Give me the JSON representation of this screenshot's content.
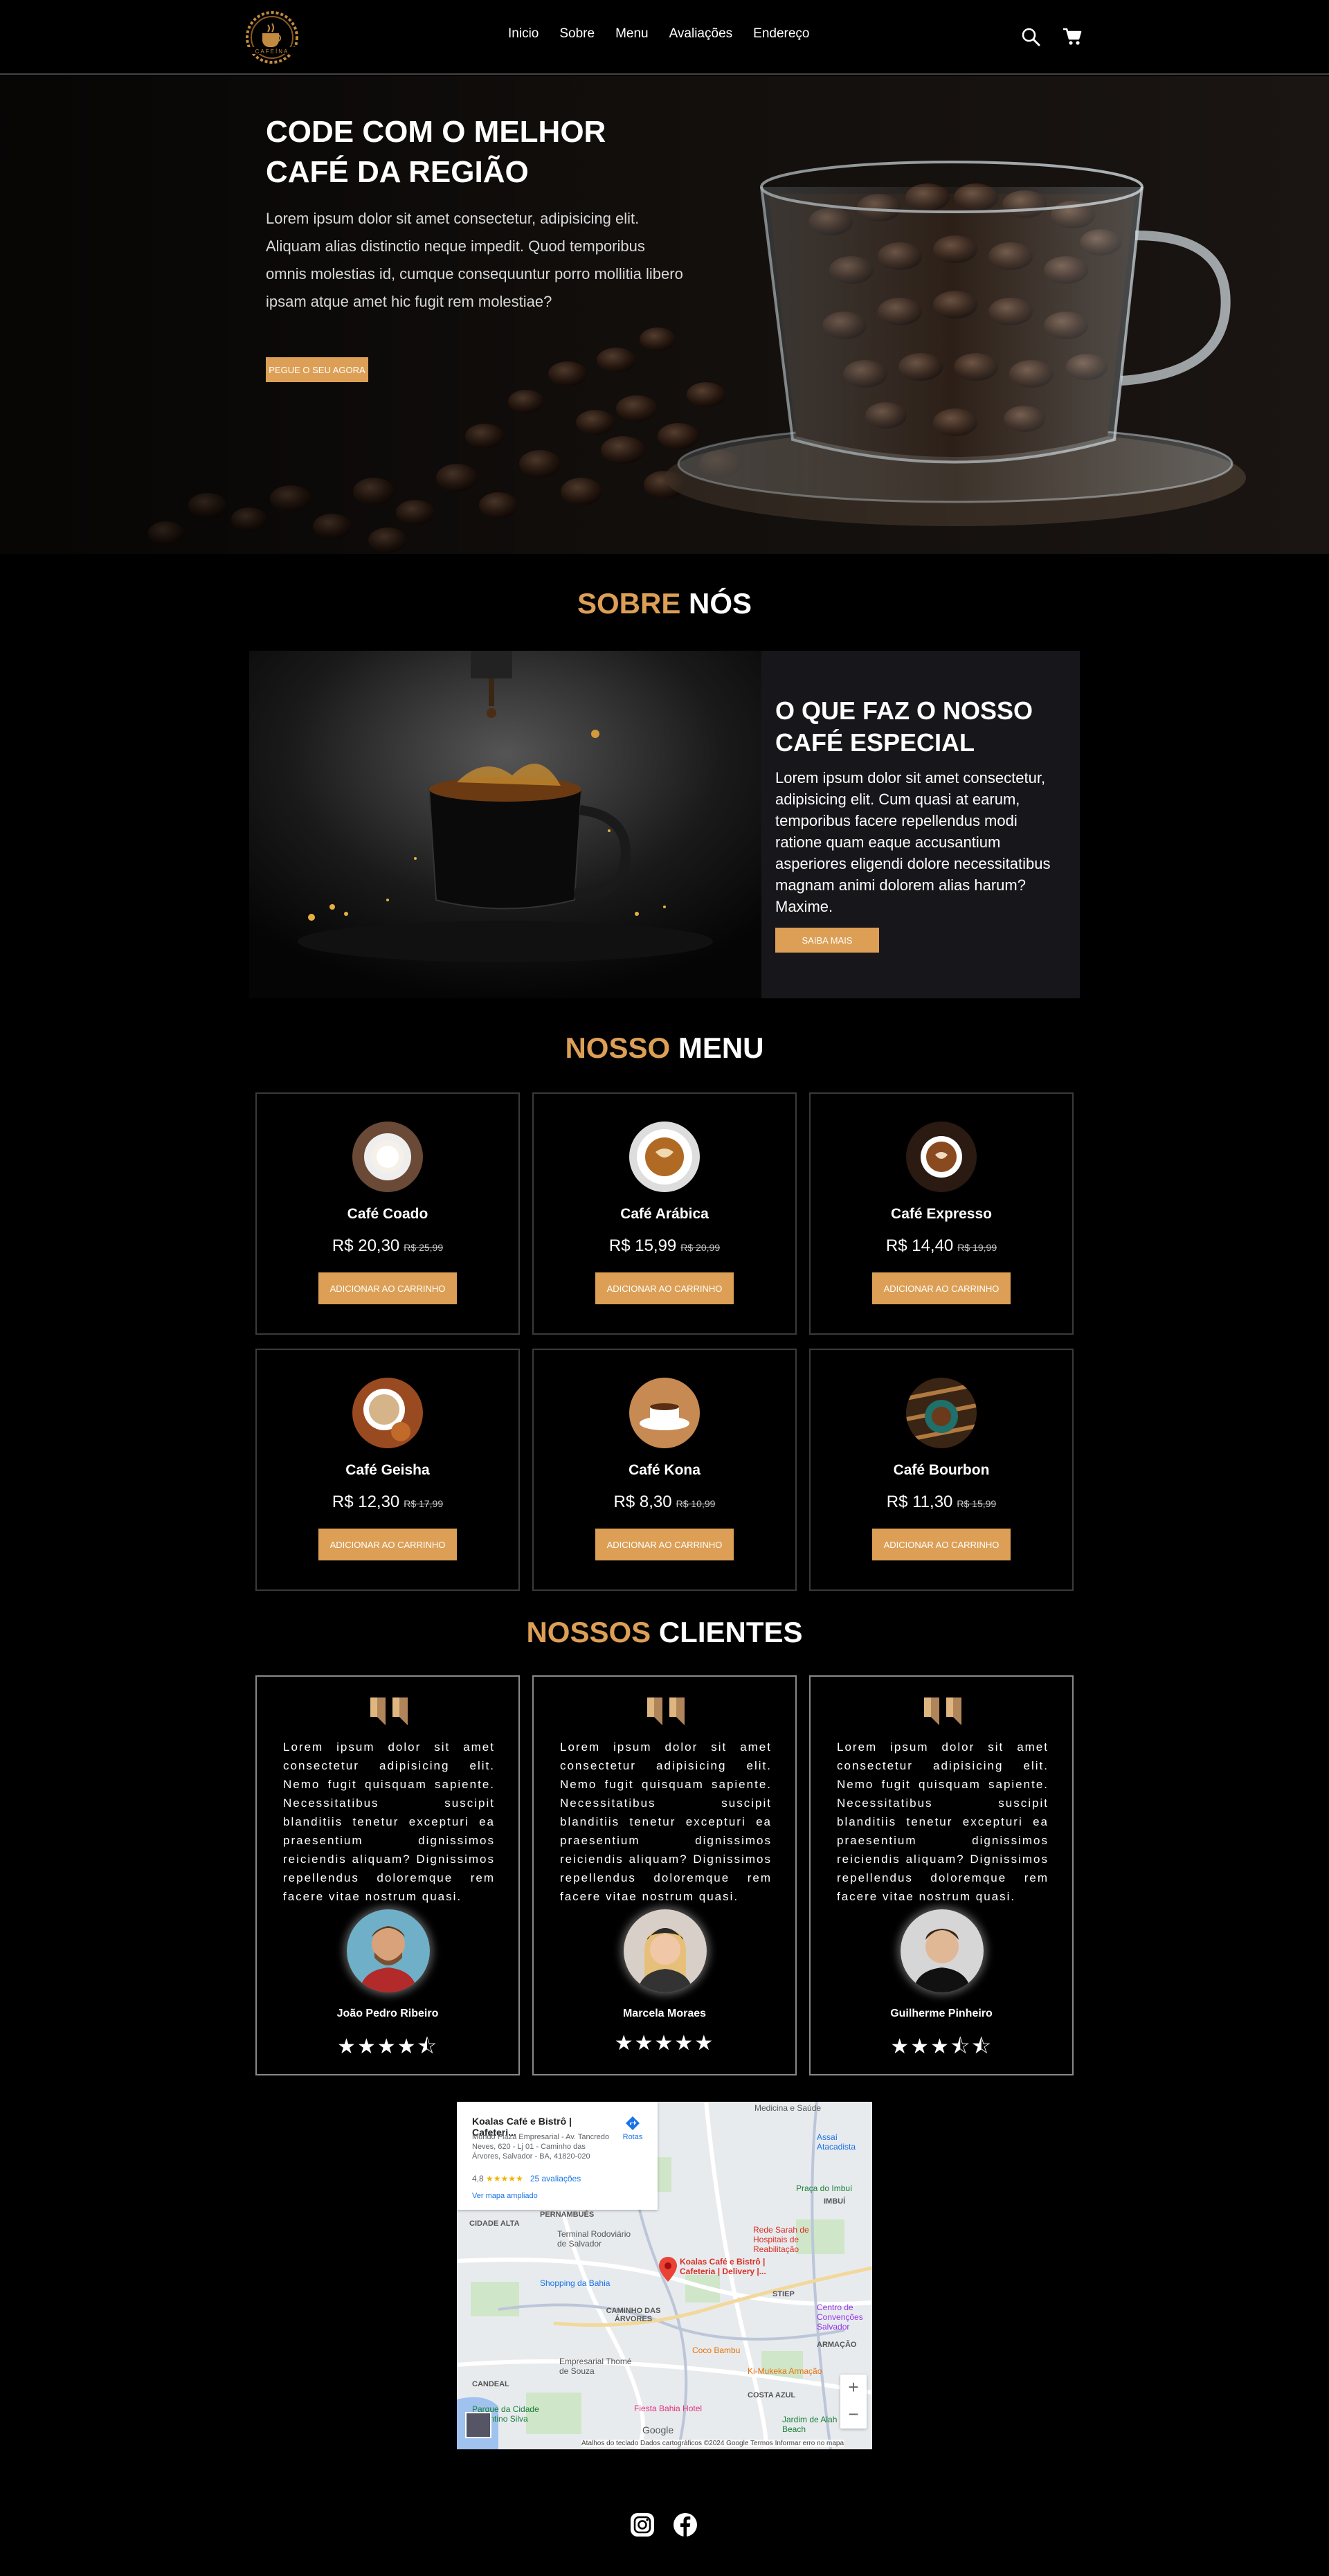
{
  "nav": {
    "logo_text": "CAFEÍNA",
    "links": [
      "Inicio",
      "Sobre",
      "Menu",
      "Avaliações",
      "Endereço"
    ],
    "icons": [
      "search-icon",
      "cart-icon"
    ]
  },
  "hero": {
    "title": "CODE COM O MELHOR CAFÉ DA REGIÃO",
    "text": "Lorem ipsum dolor sit amet consectetur, adipisicing elit. Aliquam alias distinctio neque impedit. Quod temporibus omnis molestias id, cumque consequuntur porro mollitia libero ipsam atque amet hic fugit rem molestiae?",
    "button": "PEGUE O SEU AGORA"
  },
  "about": {
    "title_accent": "SOBRE",
    "title_rest": " NÓS",
    "heading": "O QUE FAZ O NOSSO CAFÉ ESPECIAL",
    "text": "Lorem ipsum dolor sit amet consectetur, adipisicing elit. Cum quasi at earum, temporibus facere repellendus modi ratione quam eaque accusantium asperiores eligendi dolore necessitatibus magnam animi dolorem alias harum? Maxime.",
    "button": "SAIBA MAIS"
  },
  "menu": {
    "title_accent": "NOSSO",
    "title_rest": " MENU",
    "button_label": "ADICIONAR AO CARRINHO",
    "items": [
      {
        "name": "Café Coado",
        "price": "R$ 20,30",
        "old_price": "R$ 25,99"
      },
      {
        "name": "Café Arábica",
        "price": "R$ 15,99",
        "old_price": "R$ 20,99"
      },
      {
        "name": "Café Expresso",
        "price": "R$ 14,40",
        "old_price": "R$ 19,99"
      },
      {
        "name": "Café Geisha",
        "price": "R$ 12,30",
        "old_price": "R$ 17,99"
      },
      {
        "name": "Café Kona",
        "price": "R$ 8,30",
        "old_price": "R$ 10,99"
      },
      {
        "name": "Café Bourbon",
        "price": "R$ 11,30",
        "old_price": "R$ 15,99"
      }
    ]
  },
  "clients": {
    "title_accent": "NOSSOS",
    "title_rest": " CLIENTES",
    "items": [
      {
        "text": "Lorem ipsum dolor sit amet consectetur adipisicing elit. Nemo fugit quisquam sapiente. Necessitatibus suscipit blanditiis tenetur excepturi ea praesentium dignissimos reiciendis aliquam? Dignissimos repellendus doloremque rem facere vitae nostrum quasi.",
        "name": "João Pedro Ribeiro",
        "rating": 4.5
      },
      {
        "text": "Lorem ipsum dolor sit amet consectetur adipisicing elit. Nemo fugit quisquam sapiente. Necessitatibus suscipit blanditiis tenetur excepturi ea praesentium dignissimos reiciendis aliquam? Dignissimos repellendus doloremque rem facere vitae nostrum quasi.",
        "name": "Marcela Moraes",
        "rating": 5
      },
      {
        "text": "Lorem ipsum dolor sit amet consectetur adipisicing elit. Nemo fugit quisquam sapiente. Necessitatibus suscipit blanditiis tenetur excepturi ea praesentium dignissimos reiciendis aliquam? Dignissimos repellendus doloremque rem facere vitae nostrum quasi.",
        "name": "Guilherme Pinheiro",
        "rating": 3.5
      }
    ]
  },
  "map": {
    "place_name": "Koalas Café e Bistrô | Cafeteri...",
    "address": "Mundo Plaza Empresarial - Av. Tancredo Neves, 620 - Lj 01 - Caminho das Árvores, Salvador - BA, 41820-020",
    "rating": "4,8",
    "reviews": "25 avaliações",
    "bigger_map": "Ver mapa ampliado",
    "routes": "Rotas",
    "marker_label": "Koalas Café e Bistrô | Cafeteria | Delivery |...",
    "labels": [
      "PERNAMBUÉS",
      "CIDADE ALTA",
      "CAMINHO DAS ÁRVORES",
      "COSTA AZUL",
      "IMBUÍ",
      "STIEP",
      "ARMAÇÃO",
      "CANDEAL"
    ],
    "pois": [
      "Terminal Rodoviário de Salvador",
      "Shopping da Bahia",
      "Rede Sarah de Hospitais de Reabilitação",
      "Coco Bambu",
      "Fiesta Bahia Hotel",
      "Parque da Cidade Joventino Silva",
      "Centro de Convenções Salvador",
      "Praça do Imbuí",
      "Jardim de Alah Beach",
      "Assaí Atacadista",
      "Ki-Mukeka Armação",
      "Empresarial Thomé de Souza",
      "Medicina e Saúde"
    ],
    "footer": "Atalhos do teclado   Dados cartográficos ©2024 Google   Termos   Informar erro no mapa",
    "brand": "Google"
  },
  "social": {
    "icons": [
      "instagram-icon",
      "facebook-icon"
    ]
  }
}
